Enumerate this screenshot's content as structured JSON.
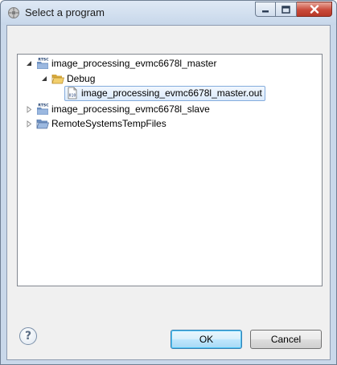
{
  "window": {
    "title": "Select a program",
    "controls": [
      "minimize",
      "maximize",
      "close"
    ]
  },
  "tree": {
    "items": [
      {
        "label": "image_processing_evmc6678l_master",
        "icon": "rtsc-project-icon",
        "expanded": true,
        "level": 0
      },
      {
        "label": "Debug",
        "icon": "open-folder-icon",
        "expanded": true,
        "level": 1
      },
      {
        "label": "image_processing_evmc6678l_master.out",
        "icon": "binary-file-icon",
        "selected": true,
        "level": 2
      },
      {
        "label": "image_processing_evmc6678l_slave",
        "icon": "rtsc-project-icon",
        "expanded": false,
        "level": 0
      },
      {
        "label": "RemoteSystemsTempFiles",
        "icon": "folder-project-icon",
        "expanded": false,
        "level": 0
      }
    ]
  },
  "buttons": {
    "help": "?",
    "ok": "OK",
    "cancel": "Cancel"
  },
  "colors": {
    "selection_border": "#84acdd",
    "title_bar": "#c7d7ea",
    "close_button": "#c94a3a"
  }
}
